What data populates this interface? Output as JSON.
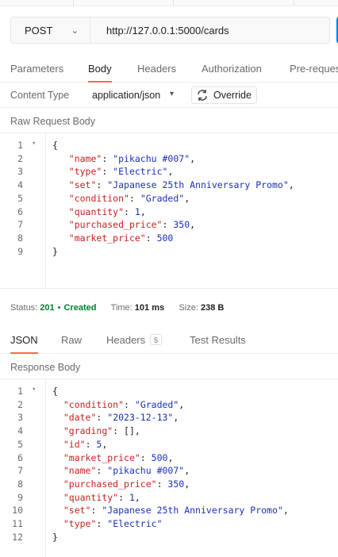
{
  "request": {
    "method": "POST",
    "url": "http://127.0.0.1:5000/cards"
  },
  "request_tabs": [
    "Parameters",
    "Body",
    "Headers",
    "Authorization",
    "Pre-reques"
  ],
  "content_type": {
    "label": "Content Type",
    "value": "application/json",
    "override_label": "Override"
  },
  "request_body": {
    "title": "Raw Request Body",
    "lines": [
      {
        "n": "1",
        "fold": "▾",
        "parts": [
          [
            "p",
            "{"
          ]
        ]
      },
      {
        "n": "2",
        "parts": [
          [
            "p",
            "   "
          ],
          [
            "k",
            "\"name\""
          ],
          [
            "p",
            ": "
          ],
          [
            "s",
            "\"pikachu #007\""
          ],
          [
            "p",
            ","
          ]
        ]
      },
      {
        "n": "3",
        "parts": [
          [
            "p",
            "   "
          ],
          [
            "k",
            "\"type\""
          ],
          [
            "p",
            ": "
          ],
          [
            "s",
            "\"Electric\""
          ],
          [
            "p",
            ","
          ]
        ]
      },
      {
        "n": "4",
        "parts": [
          [
            "p",
            "   "
          ],
          [
            "k",
            "\"set\""
          ],
          [
            "p",
            ": "
          ],
          [
            "s",
            "\"Japanese 25th Anniversary Promo\""
          ],
          [
            "p",
            ","
          ]
        ]
      },
      {
        "n": "5",
        "parts": [
          [
            "p",
            "   "
          ],
          [
            "k",
            "\"condition\""
          ],
          [
            "p",
            ": "
          ],
          [
            "s",
            "\"Graded\""
          ],
          [
            "p",
            ","
          ]
        ]
      },
      {
        "n": "6",
        "parts": [
          [
            "p",
            "   "
          ],
          [
            "k",
            "\"quantity\""
          ],
          [
            "p",
            ": "
          ],
          [
            "n",
            "1"
          ],
          [
            "p",
            ","
          ]
        ]
      },
      {
        "n": "7",
        "parts": [
          [
            "p",
            "   "
          ],
          [
            "k",
            "\"purchased_price\""
          ],
          [
            "p",
            ": "
          ],
          [
            "n",
            "350"
          ],
          [
            "p",
            ","
          ]
        ]
      },
      {
        "n": "8",
        "parts": [
          [
            "p",
            "   "
          ],
          [
            "k",
            "\"market_price\""
          ],
          [
            "p",
            ": "
          ],
          [
            "n",
            "500"
          ]
        ]
      },
      {
        "n": "9",
        "parts": [
          [
            "p",
            "}"
          ]
        ]
      }
    ]
  },
  "response_status": {
    "status_label": "Status:",
    "status_code": "201",
    "status_text": "Created",
    "time_label": "Time:",
    "time_value": "101 ms",
    "size_label": "Size:",
    "size_value": "238 B"
  },
  "response_tabs": {
    "json": "JSON",
    "raw": "Raw",
    "headers": "Headers",
    "headers_count": "5",
    "tests": "Test Results"
  },
  "response_body": {
    "title": "Response Body",
    "lines": [
      {
        "n": "1",
        "fold": "▾",
        "parts": [
          [
            "p",
            "{"
          ]
        ]
      },
      {
        "n": "2",
        "parts": [
          [
            "p",
            "  "
          ],
          [
            "k",
            "\"condition\""
          ],
          [
            "p",
            ": "
          ],
          [
            "s",
            "\"Graded\""
          ],
          [
            "p",
            ","
          ]
        ]
      },
      {
        "n": "3",
        "parts": [
          [
            "p",
            "  "
          ],
          [
            "k",
            "\"date\""
          ],
          [
            "p",
            ": "
          ],
          [
            "s",
            "\"2023-12-13\""
          ],
          [
            "p",
            ","
          ]
        ]
      },
      {
        "n": "4",
        "parts": [
          [
            "p",
            "  "
          ],
          [
            "k",
            "\"grading\""
          ],
          [
            "p",
            ": [],"
          ]
        ]
      },
      {
        "n": "5",
        "parts": [
          [
            "p",
            "  "
          ],
          [
            "k",
            "\"id\""
          ],
          [
            "p",
            ": "
          ],
          [
            "n",
            "5"
          ],
          [
            "p",
            ","
          ]
        ]
      },
      {
        "n": "6",
        "parts": [
          [
            "p",
            "  "
          ],
          [
            "k",
            "\"market_price\""
          ],
          [
            "p",
            ": "
          ],
          [
            "n",
            "500"
          ],
          [
            "p",
            ","
          ]
        ]
      },
      {
        "n": "7",
        "parts": [
          [
            "p",
            "  "
          ],
          [
            "k",
            "\"name\""
          ],
          [
            "p",
            ": "
          ],
          [
            "s",
            "\"pikachu #007\""
          ],
          [
            "p",
            ","
          ]
        ]
      },
      {
        "n": "8",
        "parts": [
          [
            "p",
            "  "
          ],
          [
            "k",
            "\"purchased_price\""
          ],
          [
            "p",
            ": "
          ],
          [
            "n",
            "350"
          ],
          [
            "p",
            ","
          ]
        ]
      },
      {
        "n": "9",
        "parts": [
          [
            "p",
            "  "
          ],
          [
            "k",
            "\"quantity\""
          ],
          [
            "p",
            ": "
          ],
          [
            "n",
            "1"
          ],
          [
            "p",
            ","
          ]
        ]
      },
      {
        "n": "10",
        "parts": [
          [
            "p",
            "  "
          ],
          [
            "k",
            "\"set\""
          ],
          [
            "p",
            ": "
          ],
          [
            "s",
            "\"Japanese 25th Anniversary Promo\""
          ],
          [
            "p",
            ","
          ]
        ]
      },
      {
        "n": "11",
        "parts": [
          [
            "p",
            "  "
          ],
          [
            "k",
            "\"type\""
          ],
          [
            "p",
            ": "
          ],
          [
            "s",
            "\"Electric\""
          ]
        ]
      },
      {
        "n": "12",
        "parts": [
          [
            "p",
            "}"
          ]
        ]
      }
    ]
  },
  "colors": {
    "accent": "#ff6c37",
    "send": "#097bed",
    "key": "#c5221f",
    "string": "#1a31b4",
    "success": "#007f31"
  }
}
